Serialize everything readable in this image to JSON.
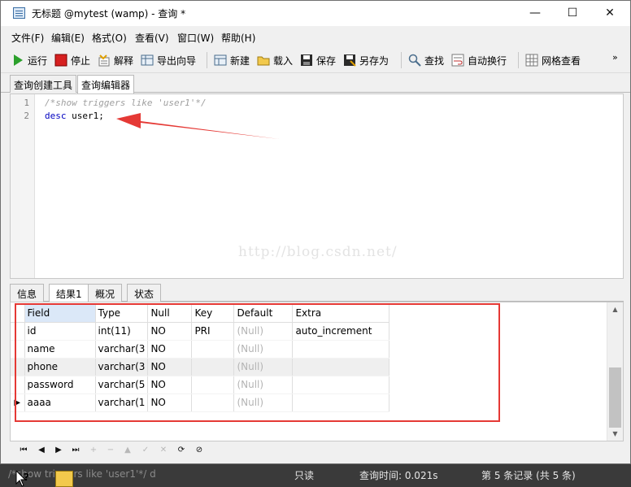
{
  "window": {
    "title": "无标题 @mytest (wamp) - 查询 *",
    "controls": {
      "minimize": "—",
      "maximize": "☐",
      "close": "✕"
    }
  },
  "menu": [
    "文件(F)",
    "编辑(E)",
    "格式(O)",
    "查看(V)",
    "窗口(W)",
    "帮助(H)"
  ],
  "toolbar": {
    "run": "运行",
    "stop": "停止",
    "explain": "解释",
    "export_wizard": "导出向导",
    "new": "新建",
    "load": "载入",
    "save": "保存",
    "save_as": "另存为",
    "find": "查找",
    "word_wrap": "自动换行",
    "grid_view": "网格查看",
    "more": "»"
  },
  "editor_tabs": [
    "查询创建工具",
    "查询编辑器"
  ],
  "editor": {
    "lines": [
      {
        "num": "1",
        "text": "/*show triggers like 'user1'*/"
      },
      {
        "num": "2",
        "keyword": "desc",
        "rest": " user1;"
      }
    ],
    "watermark": "http://blog.csdn.net/"
  },
  "result_tabs": [
    "信息",
    "结果1",
    "概况",
    "状态"
  ],
  "grid": {
    "columns": [
      "Field",
      "Type",
      "Null",
      "Key",
      "Default",
      "Extra"
    ],
    "rows": [
      [
        "id",
        "int(11)",
        "NO",
        "PRI",
        "(Null)",
        "auto_increment"
      ],
      [
        "name",
        "varchar(3",
        "NO",
        "",
        "(Null)",
        ""
      ],
      [
        "phone",
        "varchar(3",
        "NO",
        "",
        "(Null)",
        ""
      ],
      [
        "password",
        "varchar(5",
        "NO",
        "",
        "(Null)",
        ""
      ],
      [
        "aaaa",
        "varchar(1",
        "NO",
        "",
        "(Null)",
        ""
      ]
    ],
    "current_row_marker": "▶"
  },
  "navigation": {
    "first": "⏮",
    "prev": "◀",
    "next": "▶",
    "last": "⏭",
    "add": "+",
    "delete": "−",
    "edit": "▲",
    "apply": "✓",
    "cancel": "✕",
    "refresh": "⟳",
    "stop": "⊘"
  },
  "status": {
    "query_text": "/*show triggers like 'user1'*/ d",
    "readonly": "只读",
    "query_time": "查询时间: 0.021s",
    "records": "第 5 条记录 (共 5 条)"
  },
  "colors": {
    "annotation_red": "#e53935",
    "keyword_blue": "#0000c0",
    "comment_gray": "#a0a0a0",
    "null_gray": "#b4b4b4"
  }
}
